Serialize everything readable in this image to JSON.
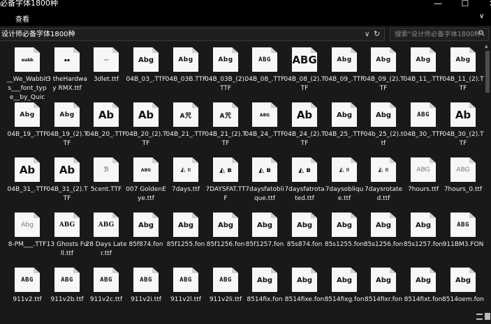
{
  "window": {
    "title": "必备字体1800种",
    "min_label": "—",
    "max_label": "☐",
    "close_label": "✕"
  },
  "menu": {
    "view_label": "查看",
    "ribbon_toggle": "∨"
  },
  "address": {
    "path": "设计师必备字体1800种",
    "dropdown": "∨",
    "refresh": "↻"
  },
  "search": {
    "placeholder": "搜索\"设计师必备字体1800种\"",
    "icon": "search-icon"
  },
  "files": [
    {
      "name": "__We_Wabbits___font_type__by_Quicc...",
      "preview": "wabb",
      "style": "sm"
    },
    {
      "name": "3 theHardway RMX.ttf",
      "preview": "▪▪",
      "style": "tiny"
    },
    {
      "name": "3dlet.ttf",
      "preview": "···",
      "style": "tiny"
    },
    {
      "name": "04B_03_.TTF",
      "preview": "Abg",
      "style": ""
    },
    {
      "name": "04B_03B.TTF",
      "preview": "Abg",
      "style": "boxy"
    },
    {
      "name": "04B_03B_(2).TTF",
      "preview": "Abg",
      "style": "boxy"
    },
    {
      "name": "04B_08_.TTF",
      "preview": "ABG",
      "style": "pix"
    },
    {
      "name": "04B_08_(2).TTF",
      "preview": "ABG",
      "style": "big"
    },
    {
      "name": "04B_09_.TTF",
      "preview": "Abg",
      "style": "boxy"
    },
    {
      "name": "04B_09_(2).TTF",
      "preview": "Abg",
      "style": "boxy"
    },
    {
      "name": "04B_11_.TTF",
      "preview": "Abg",
      "style": "boxy"
    },
    {
      "name": "04B_11_(2).TTF",
      "preview": "Abg",
      "style": "boxy"
    },
    {
      "name": "04B_19_.TTF",
      "preview": "Abg",
      "style": "boxy"
    },
    {
      "name": "04B_19_(2).TTF",
      "preview": "Abg",
      "style": "boxy"
    },
    {
      "name": "04B_20_.TTF",
      "preview": "Ab",
      "style": "big"
    },
    {
      "name": "04B_20_(2).TTF",
      "preview": "Ab",
      "style": "big"
    },
    {
      "name": "04B_21_.TTF",
      "preview": "A咒",
      "style": "boxy"
    },
    {
      "name": "04B_21_(2).TTF",
      "preview": "A咒",
      "style": "boxy"
    },
    {
      "name": "04B_24_.TTF",
      "preview": "ABG",
      "style": "tiny"
    },
    {
      "name": "04B_24_(2).TTF",
      "preview": "Ab",
      "style": "big"
    },
    {
      "name": "04B_25_.TTF",
      "preview": "Abg",
      "style": ""
    },
    {
      "name": "04b_25_(2).ttf",
      "preview": "Abg",
      "style": ""
    },
    {
      "name": "04B_30_.TTF",
      "preview": "ABG",
      "style": "pix"
    },
    {
      "name": "04B_30_(2).TTF",
      "preview": "Ab",
      "style": "big"
    },
    {
      "name": "04B_31_.TTF",
      "preview": "Ab",
      "style": "big"
    },
    {
      "name": "04B_31_(2).TTF",
      "preview": "Ab",
      "style": "big"
    },
    {
      "name": "5cent.TTF",
      "preview": "ℬ",
      "style": "thin"
    },
    {
      "name": "007 GoldenEye.ttf",
      "preview": "ABG",
      "style": "tiny"
    },
    {
      "name": "7days.ttf",
      "preview": "◭ ʙ",
      "style": "thin"
    },
    {
      "name": "7DAYSFAT.TTF",
      "preview": "◭ ʙ",
      "style": ""
    },
    {
      "name": "7daysfatoblique.ttf",
      "preview": "◭ ʙ",
      "style": ""
    },
    {
      "name": "7daysfatrotated.ttf",
      "preview": "◭ ʙ",
      "style": ""
    },
    {
      "name": "7daysoblique.ttf",
      "preview": "◭ ʙ",
      "style": "thin"
    },
    {
      "name": "7daysrotated.ttf",
      "preview": "◭ ʙ",
      "style": "thin"
    },
    {
      "name": "7hours.ttf",
      "preview": "ABG",
      "style": "outline"
    },
    {
      "name": "7hours_0.ttf",
      "preview": "ABG",
      "style": "outline"
    },
    {
      "name": "8-PM___.TTF",
      "preview": "Abg",
      "style": "outline"
    },
    {
      "name": "13 Ghosts Full.ttf",
      "preview": "ABG",
      "style": "serif"
    },
    {
      "name": "28 Days Later.ttf",
      "preview": "ABG",
      "style": "serif"
    },
    {
      "name": "85f874.fon",
      "preview": "Abg",
      "style": ""
    },
    {
      "name": "85f1255.fon",
      "preview": "Abg",
      "style": ""
    },
    {
      "name": "85f1256.fon",
      "preview": "Abg",
      "style": ""
    },
    {
      "name": "85f1257.fon",
      "preview": "Abg",
      "style": ""
    },
    {
      "name": "85s874.fon",
      "preview": "Abg",
      "style": ""
    },
    {
      "name": "85s1255.fon",
      "preview": "Abg",
      "style": ""
    },
    {
      "name": "85s1256.fon",
      "preview": "Abg",
      "style": ""
    },
    {
      "name": "85s1257.fon",
      "preview": "Abg",
      "style": ""
    },
    {
      "name": "911BM3.FON",
      "preview": "ABG",
      "style": "pix"
    },
    {
      "name": "911v2.ttf",
      "preview": "ABG",
      "style": "pix"
    },
    {
      "name": "911v2b.ttf",
      "preview": "ABG",
      "style": "pix"
    },
    {
      "name": "911v2c.ttf",
      "preview": "ABG",
      "style": "pix"
    },
    {
      "name": "911v2i.ttf",
      "preview": "ABG",
      "style": "pix"
    },
    {
      "name": "911v2l.ttf",
      "preview": "ABG",
      "style": "pix"
    },
    {
      "name": "911v2li.ttf",
      "preview": "ABG",
      "style": "pix"
    },
    {
      "name": "8514fix.fon",
      "preview": "Abg",
      "style": ""
    },
    {
      "name": "8514fixe.fon",
      "preview": "Abg",
      "style": ""
    },
    {
      "name": "8514fixg.fon",
      "preview": "Abg",
      "style": ""
    },
    {
      "name": "8514fixr.fon",
      "preview": "Abg",
      "style": ""
    },
    {
      "name": "8514fixt.fon",
      "preview": "Abg",
      "style": ""
    },
    {
      "name": "8514oem.fon",
      "preview": "Abg",
      "style": ""
    }
  ],
  "status": {
    "scroll_up": "▲",
    "scroll_down": "▼"
  }
}
